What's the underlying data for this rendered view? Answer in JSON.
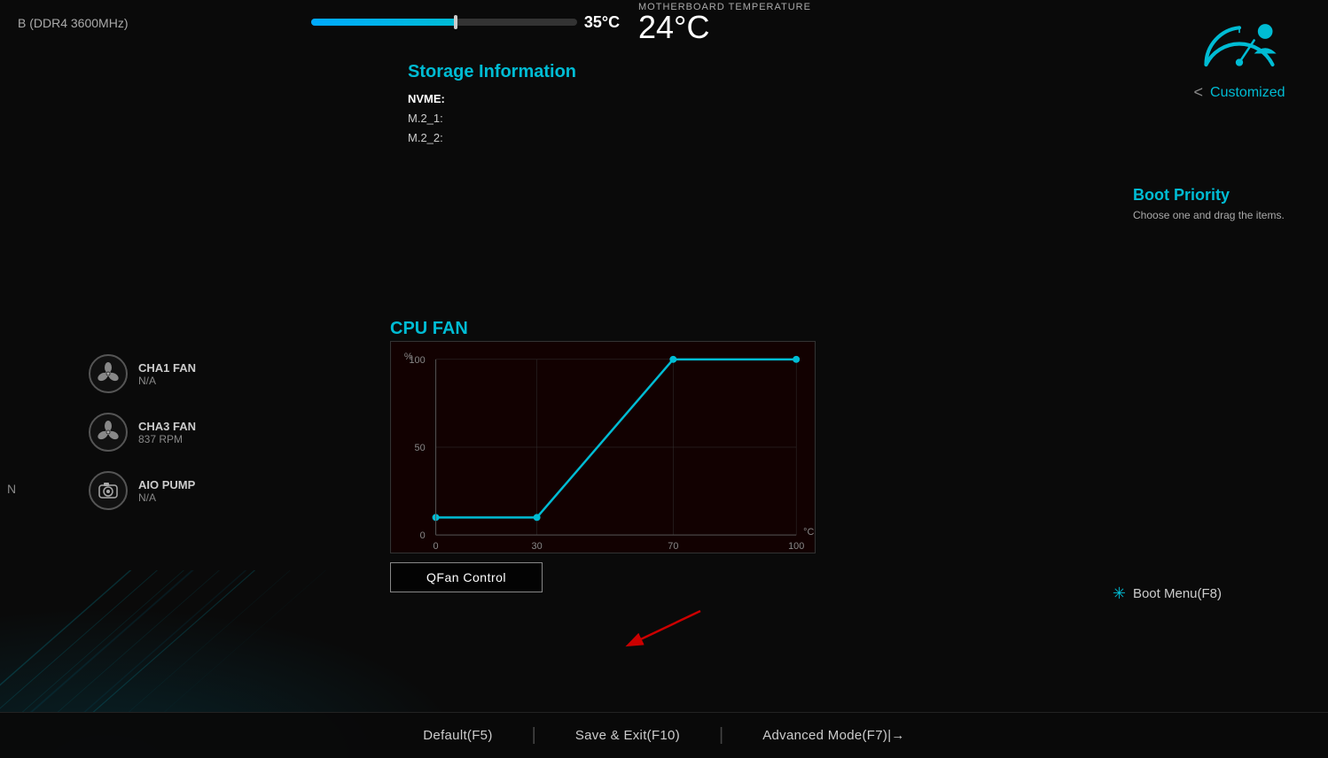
{
  "header": {
    "ram_label": "B (DDR4 3600MHz)",
    "cpu_temp": "35°C",
    "mb_temp_label": "Motherboard Temperature",
    "mb_temp_value": "24°C"
  },
  "storage": {
    "title": "Storage Information",
    "nvme_label": "NVME:",
    "m2_1_label": "M.2_1:",
    "m2_1_value": "",
    "m2_2_label": "M.2_2:",
    "m2_2_value": ""
  },
  "profile": {
    "chevron": "<",
    "label": "Customized"
  },
  "boot_priority": {
    "title": "Boot Priority",
    "description": "Choose one and drag the items."
  },
  "fans": [
    {
      "name": "CHA1 FAN",
      "speed": "N/A",
      "icon": "fan"
    },
    {
      "name": "CHA3 FAN",
      "speed": "837 RPM",
      "icon": "fan"
    },
    {
      "name": "AIO PUMP",
      "speed": "N/A",
      "icon": "pump"
    }
  ],
  "left_edge_label": "N",
  "cpu_fan": {
    "title": "CPU FAN",
    "y_label": "%",
    "x_label": "°C",
    "y_ticks": [
      100,
      50,
      0
    ],
    "x_ticks": [
      0,
      30,
      70,
      100
    ]
  },
  "qfan_btn": "QFan Control",
  "boot_menu_btn": "Boot Menu(F8)",
  "bottom_bar": {
    "default_btn": "Default(F5)",
    "save_exit_btn": "Save & Exit(F10)",
    "advanced_btn": "Advanced Mode(F7)|→"
  }
}
